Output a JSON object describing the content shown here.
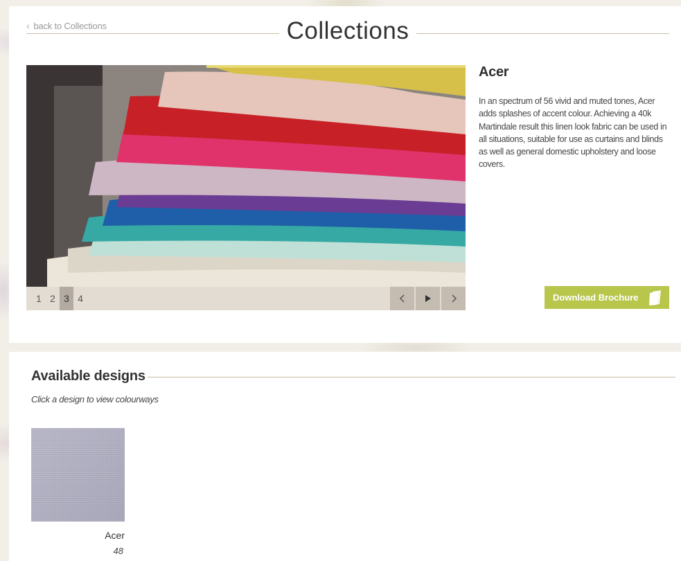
{
  "header": {
    "back_link": "back to Collections",
    "title": "Collections"
  },
  "slideshow": {
    "pages": [
      "1",
      "2",
      "3",
      "4"
    ],
    "active_page": "3",
    "image_subject": "stack of folded linen fabrics"
  },
  "collection": {
    "name": "Acer",
    "description": "In an spectrum of 56 vivid and muted tones, Acer adds splashes of accent colour. Achieving a 40k Martindale result this linen look fabric can be used in all situations, suitable for use as curtains and blinds as well as general domestic upholstery and loose covers.",
    "download_label": "Download Brochure"
  },
  "designs": {
    "title": "Available designs",
    "subtitle": "Click a design to view colourways",
    "items": [
      {
        "name": "Acer",
        "count": "48"
      }
    ]
  },
  "colors": {
    "accent_line": "#c8bea3",
    "download_button": "#b8c64b",
    "controls_bar": "#e2dcd3",
    "controls_button": "#c4bcb1",
    "swatch": "#b2b1c2"
  },
  "icons": {
    "back": "chevron-left-icon",
    "prev": "chevron-left-icon",
    "play": "play-icon",
    "next": "chevron-right-icon",
    "download": "document-icon"
  }
}
